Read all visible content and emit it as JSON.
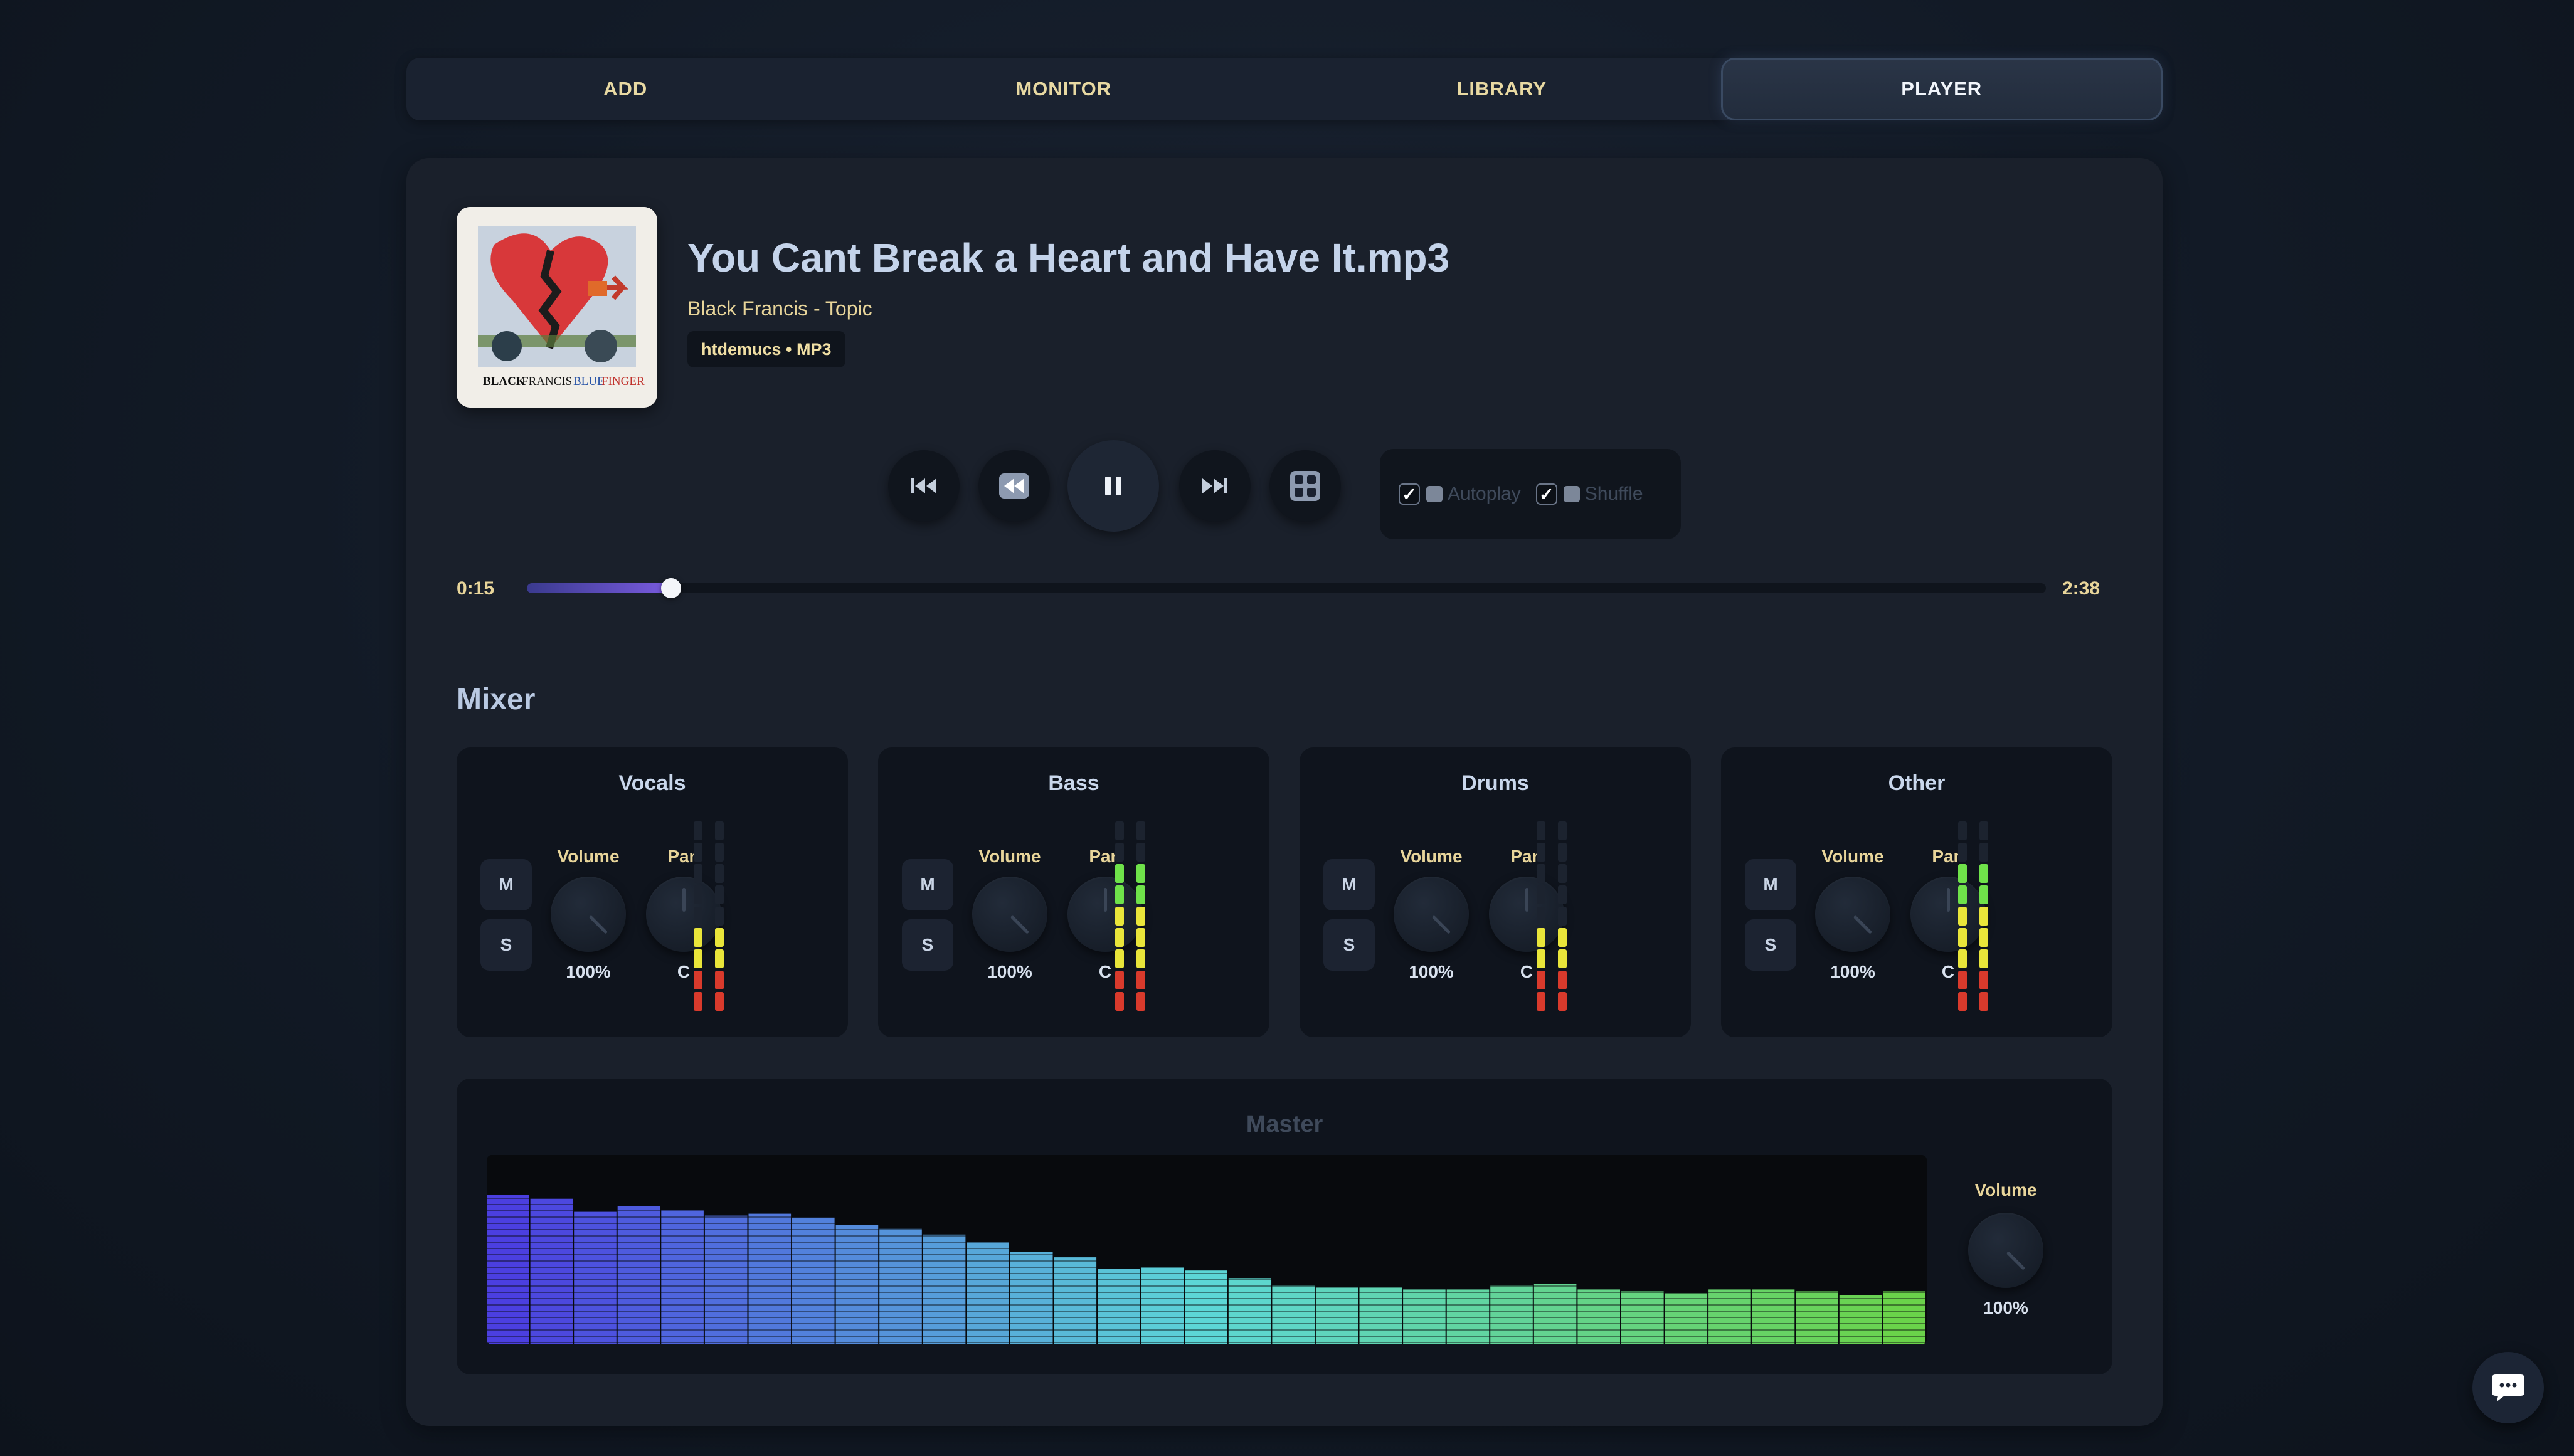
{
  "tabs": [
    {
      "label": "ADD",
      "active": false
    },
    {
      "label": "MONITOR",
      "active": false
    },
    {
      "label": "LIBRARY",
      "active": false
    },
    {
      "label": "PLAYER",
      "active": true
    }
  ],
  "track": {
    "title": "You Cant Break a Heart and Have It.mp3",
    "artist": "Black Francis - Topic",
    "tag": "htdemucs • MP3",
    "cover_caption_black": "BLACK",
    "cover_caption_francis": "FRANCIS",
    "cover_caption_blue": "BLUE",
    "cover_caption_finger": "FINGER"
  },
  "transport": {
    "buttons": [
      "skip-back-icon",
      "rewind-icon",
      "pause-icon",
      "skip-forward-icon",
      "grid-icon"
    ],
    "autoplay_label": "Autoplay",
    "autoplay_checked": true,
    "shuffle_label": "Shuffle",
    "shuffle_checked": true,
    "checkmark": "✓"
  },
  "progress": {
    "current": "0:15",
    "total": "2:38",
    "fraction": 0.095
  },
  "mixer": {
    "title": "Mixer",
    "mute_label": "M",
    "solo_label": "S",
    "volume_label": "Volume",
    "pan_label": "Pan",
    "strips": [
      {
        "name": "Vocals",
        "volume": "100%",
        "pan": "C",
        "meter_level": 4
      },
      {
        "name": "Bass",
        "volume": "100%",
        "pan": "C",
        "meter_level": 7
      },
      {
        "name": "Drums",
        "volume": "100%",
        "pan": "C",
        "meter_level": 4
      },
      {
        "name": "Other",
        "volume": "100%",
        "pan": "C",
        "meter_level": 7
      }
    ]
  },
  "master": {
    "title": "Master",
    "volume_label": "Volume",
    "volume": "100%",
    "spectrum_levels": [
      0.79,
      0.77,
      0.7,
      0.73,
      0.71,
      0.68,
      0.69,
      0.67,
      0.63,
      0.61,
      0.58,
      0.54,
      0.49,
      0.46,
      0.4,
      0.41,
      0.39,
      0.35,
      0.31,
      0.3,
      0.3,
      0.29,
      0.29,
      0.31,
      0.32,
      0.29,
      0.28,
      0.27,
      0.29,
      0.29,
      0.28,
      0.26,
      0.28
    ],
    "spectrum_colors": [
      "#4b3fe0",
      "#5cd6d6",
      "#6ad24a"
    ]
  },
  "chat": {
    "icon": "chat-bubble-icon"
  }
}
